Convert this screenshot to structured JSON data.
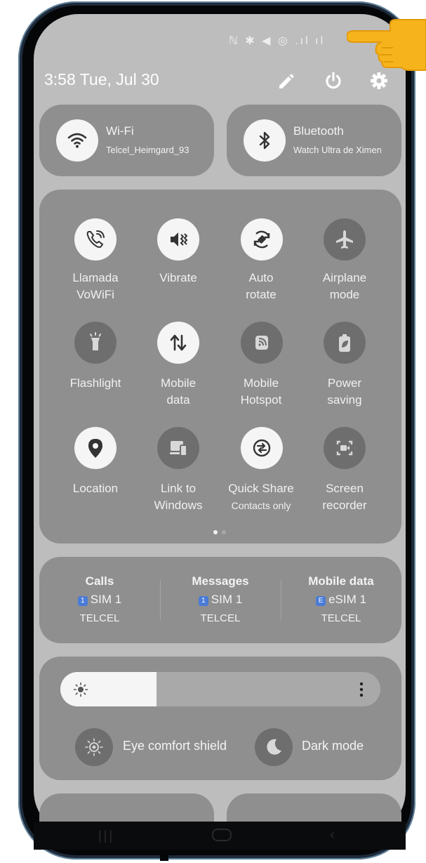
{
  "status_bar": {
    "icons": "ℕ ✱ ◀ ◎ .ıl ıl"
  },
  "header": {
    "time_date": "3:58  Tue, Jul 30"
  },
  "wifi": {
    "title": "Wi-Fi",
    "network": "Telcel_Heimgard_93"
  },
  "bluetooth": {
    "title": "Bluetooth",
    "device": "Watch Ultra de Ximena"
  },
  "tiles": [
    {
      "label1": "Llamada",
      "label2": "VoWiFi",
      "state": "on"
    },
    {
      "label1": "Vibrate",
      "label2": "",
      "state": "on"
    },
    {
      "label1": "Auto",
      "label2": "rotate",
      "state": "on"
    },
    {
      "label1": "Airplane",
      "label2": "mode",
      "state": "off"
    },
    {
      "label1": "Flashlight",
      "label2": "",
      "state": "off"
    },
    {
      "label1": "Mobile",
      "label2": "data",
      "state": "on"
    },
    {
      "label1": "Mobile",
      "label2": "Hotspot",
      "state": "off"
    },
    {
      "label1": "Power",
      "label2": "saving",
      "state": "off"
    },
    {
      "label1": "Location",
      "label2": "",
      "state": "on"
    },
    {
      "label1": "Link to",
      "label2": "Windows",
      "state": "off"
    },
    {
      "label1": "Quick Share",
      "label2": "Contacts only",
      "state": "on"
    },
    {
      "label1": "Screen",
      "label2": "recorder",
      "state": "off"
    }
  ],
  "sim": {
    "calls": {
      "title": "Calls",
      "badge": "1",
      "sim": "SIM 1",
      "carrier": "TELCEL"
    },
    "messages": {
      "title": "Messages",
      "badge": "1",
      "sim": "SIM 1",
      "carrier": "TELCEL"
    },
    "mobile_data": {
      "title": "Mobile data",
      "badge": "E",
      "sim": "eSIM 1",
      "carrier": "TELCEL"
    }
  },
  "brightness": {
    "level": 0.3
  },
  "display": {
    "eye_comfort": "Eye comfort shield",
    "dark_mode": "Dark mode"
  },
  "colors": {
    "panel": "#8f8f8f",
    "tile_on": "#f5f5f5",
    "tile_off": "#6e6e6e",
    "background": "#bdbdbd",
    "pointer": "#f6b31b"
  }
}
